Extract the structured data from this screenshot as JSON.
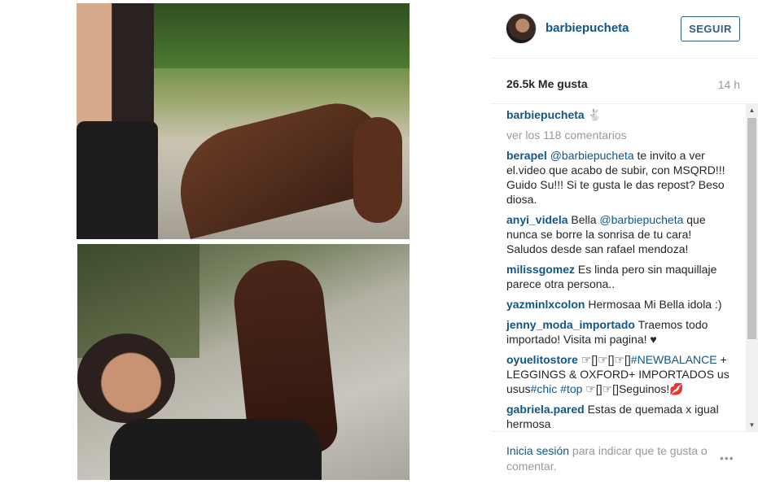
{
  "post": {
    "username": "barbiepucheta",
    "follow_label": "SEGUIR",
    "likes": "26.5k Me gusta",
    "age": "14 h",
    "caption_user": "barbiepucheta",
    "caption_emoji": "🐇",
    "view_all": "ver los 118 comentarios"
  },
  "comments": [
    {
      "user": "berapel",
      "segments": [
        {
          "type": "mention",
          "text": "@barbiepucheta"
        },
        {
          "type": "text",
          "text": " te invito a ver el.video que acabo de subir, con MSQRD!!! Guido Su!!! Si te gusta le das repost? Beso diosa."
        }
      ]
    },
    {
      "user": "anyi_videla",
      "segments": [
        {
          "type": "text",
          "text": "Bella "
        },
        {
          "type": "mention",
          "text": "@barbiepucheta"
        },
        {
          "type": "text",
          "text": " que nunca se borre la sonrisa de tu cara! Saludos desde san rafael mendoza!"
        }
      ]
    },
    {
      "user": "milissgomez",
      "segments": [
        {
          "type": "text",
          "text": "Es linda pero sin maquillaje parece otra persona.."
        }
      ]
    },
    {
      "user": "yazminlxcolon",
      "segments": [
        {
          "type": "text",
          "text": "Hermosaa Mi Bella idola :)"
        }
      ]
    },
    {
      "user": "jenny_moda_importado",
      "segments": [
        {
          "type": "text",
          "text": "Traemos todo importado! Visita mi pagina! ♥"
        }
      ]
    },
    {
      "user": "oyuelitostore",
      "segments": [
        {
          "type": "text",
          "text": "☞[]☞[]☞[]"
        },
        {
          "type": "tag",
          "text": "#NEWBALANCE"
        },
        {
          "type": "text",
          "text": " + LEGGINGS & OXFORD+ IMPORTADOS us usus"
        },
        {
          "type": "tag",
          "text": "#chic"
        },
        {
          "type": "text",
          "text": " "
        },
        {
          "type": "tag",
          "text": "#top"
        },
        {
          "type": "text",
          "text": " ☞[]☞[]Seguinos!💋"
        }
      ]
    },
    {
      "user": "gabriela.pared",
      "segments": [
        {
          "type": "text",
          "text": "Estas de quemada x igual hermosa"
        }
      ]
    }
  ],
  "footer": {
    "login_label": "Inicia sesión",
    "rest": " para indicar que te gusta o comentar.",
    "more_icon": "•••"
  },
  "icons": {
    "more": "more-options-icon",
    "scroll_up": "scroll-up-arrow-icon",
    "scroll_down": "scroll-down-arrow-icon"
  },
  "colors": {
    "link": "#125688",
    "muted": "#999999",
    "follow_border": "#2e5e86"
  }
}
